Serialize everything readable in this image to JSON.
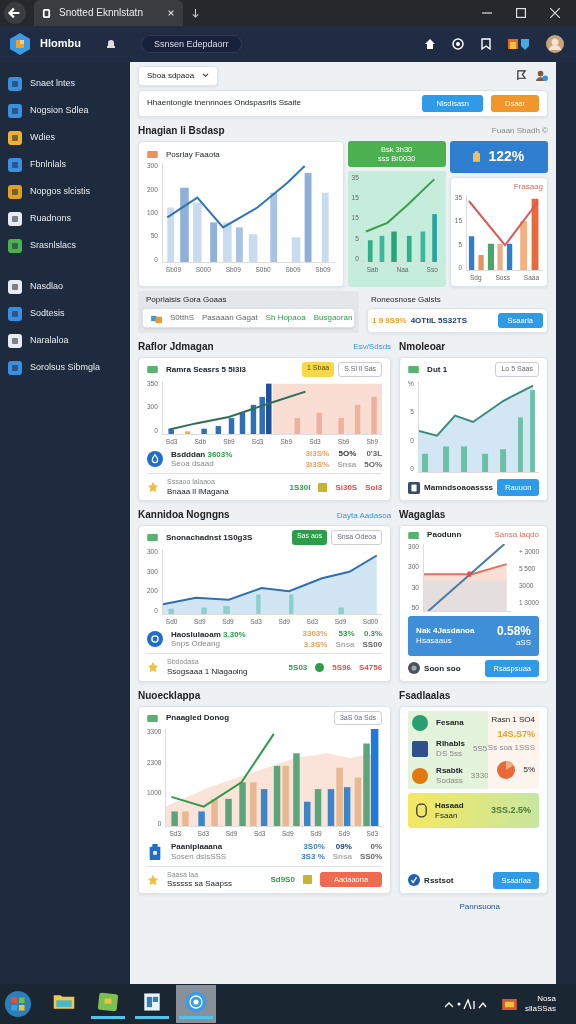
{
  "window": {
    "tab_title": "Snotted Eknnlstatn"
  },
  "app_bar": {
    "brand": "Hlombu",
    "search": "Ssnsen Edepdaorr"
  },
  "sidebar": {
    "items": [
      {
        "label": "Snaet lntes",
        "color": "#3b8fe0"
      },
      {
        "label": "Nogsion Sdlea",
        "color": "#3b8fe0"
      },
      {
        "label": "Wdies",
        "color": "#f0b030"
      },
      {
        "label": "Fbnlnlals",
        "color": "#3b8fe0"
      },
      {
        "label": "Nopgos slcistis",
        "color": "#e0a020"
      },
      {
        "label": "Ruadnons",
        "color": "#e8ecf2"
      },
      {
        "label": "Srasnlslacs",
        "color": "#4cb050"
      },
      {
        "label": "Nasdlao",
        "color": "#e8ecf2"
      },
      {
        "label": "Sodtesis",
        "color": "#3b8fe0"
      },
      {
        "label": "Naralaloa",
        "color": "#e8ecf2"
      },
      {
        "label": "Sorolsus Sibmgla",
        "color": "#3b8fe0"
      }
    ]
  },
  "toolbar": {
    "dropdown": "Sboa sdpaoa",
    "filter_text": "Hhaentongie tnennnoes Ondspasrlis Ssaite",
    "buttons": [
      {
        "label": "Nlsdlsasn",
        "kind": "primary"
      },
      {
        "label": "Dsaar",
        "kind": "warning"
      }
    ]
  },
  "overview": {
    "title": "Hnagian li Bsdasp",
    "link": "Fuaan Sbadh ©",
    "main_chart": {
      "kind": "bars_line",
      "title": "Posrlay Faaota",
      "y_labels": [
        "300",
        "200",
        "100",
        "50",
        "0"
      ],
      "x_labels": [
        "Sb09",
        "S000",
        "Sb09",
        "S0b0",
        "Sb09",
        "Sb09"
      ]
    },
    "green_badge": [
      "Bsk 3h30",
      "sss Br0030"
    ],
    "teal_chart": {
      "kind": "teal",
      "y_labels": [
        "35",
        "15",
        "15",
        "5",
        "0"
      ],
      "x_labels": [
        "Sab",
        "Naa",
        "Sso"
      ]
    },
    "blue_stat": "122%",
    "red_chart": {
      "kind": "red_v",
      "title": "Frasaag",
      "y_labels": [
        "35",
        "15",
        "5",
        "0"
      ],
      "x_labels": [
        "Sdg",
        "Soss",
        "Saaa"
      ]
    },
    "summary": {
      "title": "Poprlaisis Gora Goaas",
      "items": [
        {
          "text": "S0tthS",
          "kind": "gray"
        },
        {
          "text": "Pasaaan Gagat",
          "kind": "gray"
        },
        {
          "text": "Sh Hopaoa",
          "kind": "green"
        },
        {
          "text": "Busgaoran",
          "kind": "green"
        }
      ]
    },
    "summary_right": {
      "title": "Roneosnose Galsts",
      "values": [
        {
          "text": "1 9 9S9%",
          "kind": "amber"
        },
        {
          "text": "4OTtiL 5S32TS",
          "kind": "navy"
        }
      ],
      "button": "Ssaarla"
    }
  },
  "rows": [
    {
      "left": {
        "title": "Raflor Jdmagan",
        "link": "Esv/Sdsds",
        "chart": {
          "kind": "dense_bars",
          "title": "Ramra Seasrs 5 5I3l3",
          "badges": [
            {
              "label": "1 Sbaa",
              "kind": "yellow"
            },
            {
              "label": "S.Sl ll Sas",
              "kind": "outline"
            }
          ],
          "y_labels": [
            "350",
            "300",
            "0"
          ],
          "x_labels": [
            "Sd3",
            "Sdb",
            "Sb9",
            "Sd3",
            "Sb9",
            "Sd3",
            "Sb9",
            "Sb9"
          ]
        },
        "stats": {
          "title": "Bsdddan",
          "highlight": "3603%",
          "subtitle": "Seoa dsaad",
          "figures": [
            {
              "text": "3i3S%",
              "kind": "orange"
            },
            {
              "text": "5O%",
              "kind": "dark"
            },
            {
              "text": "0'3L",
              "kind": "gray"
            },
            {
              "text": "3i3S%",
              "kind": "orange"
            },
            {
              "text": "Snsa",
              "kind": "muted"
            },
            {
              "text": "5O%",
              "kind": "gray"
            }
          ]
        },
        "footer": {
          "lines": [
            "Sssaoo lalaaoa",
            "Bnaaa ll lMagana"
          ],
          "values": [
            {
              "text": "1S30I",
              "kind": "green"
            },
            {
              "text": "Si30S",
              "kind": "red"
            },
            {
              "text": "Sol3",
              "kind": "red"
            }
          ]
        }
      },
      "right": {
        "title": "Nmoleoar",
        "chart": {
          "kind": "area_bars",
          "title": "Dut 1",
          "badges": [
            {
              "label": "Lo 5 Saas",
              "kind": "outline"
            }
          ],
          "y_labels": [
            "%",
            "5",
            "0",
            "0"
          ]
        },
        "footer": {
          "text": "Mamndsoaoassss",
          "button": "Rauuon"
        }
      }
    },
    {
      "left": {
        "title": "Kannidoa Nogngns",
        "link": "Dayta Aadasoa",
        "chart": {
          "kind": "area_line",
          "title": "Snonachadnst 1S0g3S",
          "badges": [
            {
              "label": "Sas aos",
              "kind": "green"
            },
            {
              "label": "Snsa Odeoa",
              "kind": "outline"
            }
          ],
          "y_labels": [
            "300",
            "300",
            "200",
            "0"
          ],
          "x_labels": [
            "Sd0",
            "Sd9",
            "Sd9",
            "Sd3",
            "Sd9",
            "Sd3",
            "Sd9",
            "Sd00"
          ]
        },
        "stats": {
          "title": "Haoslulaoam",
          "highlight": "3.30%",
          "subtitle": "Snps Odeang",
          "figures": [
            {
              "text": "3303%",
              "kind": "orange"
            },
            {
              "text": "53%",
              "kind": "green"
            },
            {
              "text": "0.3%",
              "kind": "green"
            },
            {
              "text": "3.3S%",
              "kind": "orange"
            },
            {
              "text": "Snsa",
              "kind": "muted"
            },
            {
              "text": "SS00",
              "kind": "gray"
            }
          ]
        },
        "footer": {
          "lines": [
            "Sbdodasa",
            "Ssogsaaa 1 Nlagaoing"
          ],
          "values": [
            {
              "text": "5S03",
              "kind": "green"
            },
            {
              "text": "5S96",
              "kind": "red"
            },
            {
              "text": "S4756",
              "kind": "red"
            }
          ]
        }
      },
      "right": {
        "title": "Wagaglas",
        "chart": {
          "kind": "cross",
          "title": "Paodunn",
          "tag": "Sansa laqdo",
          "y_labels": [
            "300",
            "300",
            "30",
            "50"
          ],
          "side_labels": [
            "+ 3000",
            "5 500",
            "3000",
            "1 3000"
          ]
        },
        "highlight": {
          "lines": [
            "Nak 4Jasdanoa",
            "Hsasaaus"
          ],
          "value": "0.58%",
          "sub": "aSS"
        },
        "footer": {
          "text": "Soon soo",
          "button": "Rsaspsuaa"
        }
      }
    },
    {
      "left": {
        "title": "Nuoecklappa",
        "chart": {
          "kind": "multi_bars",
          "title": "Pnaagled Donog",
          "badges": [
            {
              "label": "3aS 0a Sds",
              "kind": "outline"
            }
          ],
          "y_labels": [
            "3300",
            "2300",
            "1000",
            "0"
          ],
          "x_labels": [
            "Sd3",
            "Sd3",
            "Sd9",
            "Sd3",
            "Sd9",
            "Sd9",
            "Sd9",
            "Sd3"
          ]
        },
        "stats": {
          "title": "Paaniplaaana",
          "subtitle": "Sosen dslsSSS",
          "figures": [
            {
              "text": "3S0%",
              "kind": "blue"
            },
            {
              "text": "09%",
              "kind": "navy"
            },
            {
              "text": "0%",
              "kind": "gray"
            },
            {
              "text": "3S3 %",
              "kind": "blue"
            },
            {
              "text": "Snsa",
              "kind": "muted"
            },
            {
              "text": "SS0%",
              "kind": "gray"
            }
          ]
        },
        "footer": {
          "lines": [
            "Saasa laa",
            "Ssssss sa Saapss"
          ],
          "values": [
            {
              "text": "Sd9S0",
              "kind": "green"
            }
          ],
          "button": "Aadaaona"
        }
      },
      "right": {
        "title": "Fsadlaalas",
        "items": [
          {
            "label": "Fesana",
            "color": "#2aa070"
          },
          {
            "label": "Rlhabls",
            "sub": "DS 5ss",
            "value": "5S5",
            "color": "#2f4f8f"
          },
          {
            "label": "Rsabtk",
            "sub": "Sodass",
            "value": "3330",
            "color": "#e07a10"
          }
        ],
        "side": {
          "top": "Rasn 1 SO4",
          "big": "14S.S7%",
          "sub": "Ss soa 1SSS",
          "pie": "5%"
        },
        "highlight": {
          "lines": [
            "Hasaad",
            "Fsaan"
          ],
          "value": "3SS.2.5%"
        },
        "footer": {
          "text": "Rsstsot",
          "button": "Ssaarlaa"
        }
      }
    }
  ],
  "bottom_link": "Pannsuona",
  "taskbar": {
    "apps": [
      {
        "kind": "folder",
        "selected": false
      },
      {
        "kind": "app",
        "selected": false
      },
      {
        "kind": "window",
        "selected": false
      },
      {
        "kind": "globe",
        "selected": true
      }
    ],
    "clock": [
      "Nosa",
      "sllaSSas"
    ]
  }
}
